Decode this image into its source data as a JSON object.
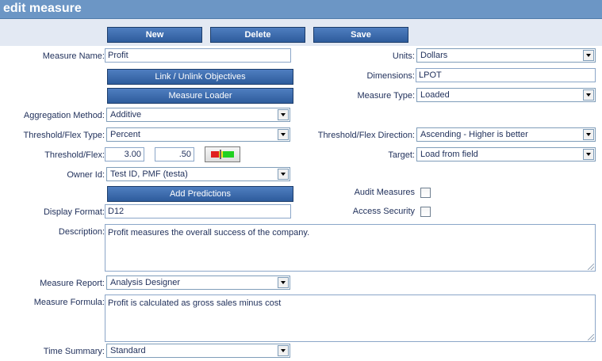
{
  "header": {
    "title": "edit measure"
  },
  "toolbar": {
    "new_label": "New",
    "delete_label": "Delete",
    "save_label": "Save"
  },
  "form": {
    "measure_name": {
      "label": "Measure Name:",
      "value": "Profit"
    },
    "link_objectives_label": "Link / Unlink Objectives",
    "measure_loader_label": "Measure Loader",
    "aggregation_method": {
      "label": "Aggregation Method:",
      "value": "Additive"
    },
    "threshold_flex_type": {
      "label": "Threshold/Flex Type:",
      "value": "Percent"
    },
    "threshold_flex": {
      "label": "Threshold/Flex:",
      "value1": "3.00",
      "value2": ".50"
    },
    "owner_id": {
      "label": "Owner Id:",
      "value": "Test ID, PMF (testa)"
    },
    "add_predictions_label": "Add Predictions",
    "display_format": {
      "label": "Display Format:",
      "value": "D12"
    },
    "units": {
      "label": "Units:",
      "value": "Dollars"
    },
    "dimensions": {
      "label": "Dimensions:",
      "value": "LPOT"
    },
    "measure_type": {
      "label": "Measure Type:",
      "value": "Loaded"
    },
    "threshold_flex_direction": {
      "label": "Threshold/Flex Direction:",
      "value": "Ascending - Higher is better"
    },
    "target": {
      "label": "Target:",
      "value": "Load from field"
    },
    "audit_measures": {
      "label": "Audit Measures",
      "checked": false
    },
    "access_security": {
      "label": "Access Security",
      "checked": false
    },
    "description": {
      "label": "Description:",
      "value": "Profit measures the overall success of the company."
    },
    "measure_report": {
      "label": "Measure Report:",
      "value": "Analysis Designer"
    },
    "measure_formula": {
      "label": "Measure Formula:",
      "value": "Profit is calculated as gross sales minus cost"
    },
    "time_summary": {
      "label": "Time Summary:",
      "value": "Standard"
    }
  },
  "colors": {
    "header": "#6c96c5",
    "toolbar": "#e3e9f3",
    "button": "#2e5c9c",
    "gauge_red": "#e02020",
    "gauge_yellow": "#f0e020",
    "gauge_green": "#20d020"
  }
}
